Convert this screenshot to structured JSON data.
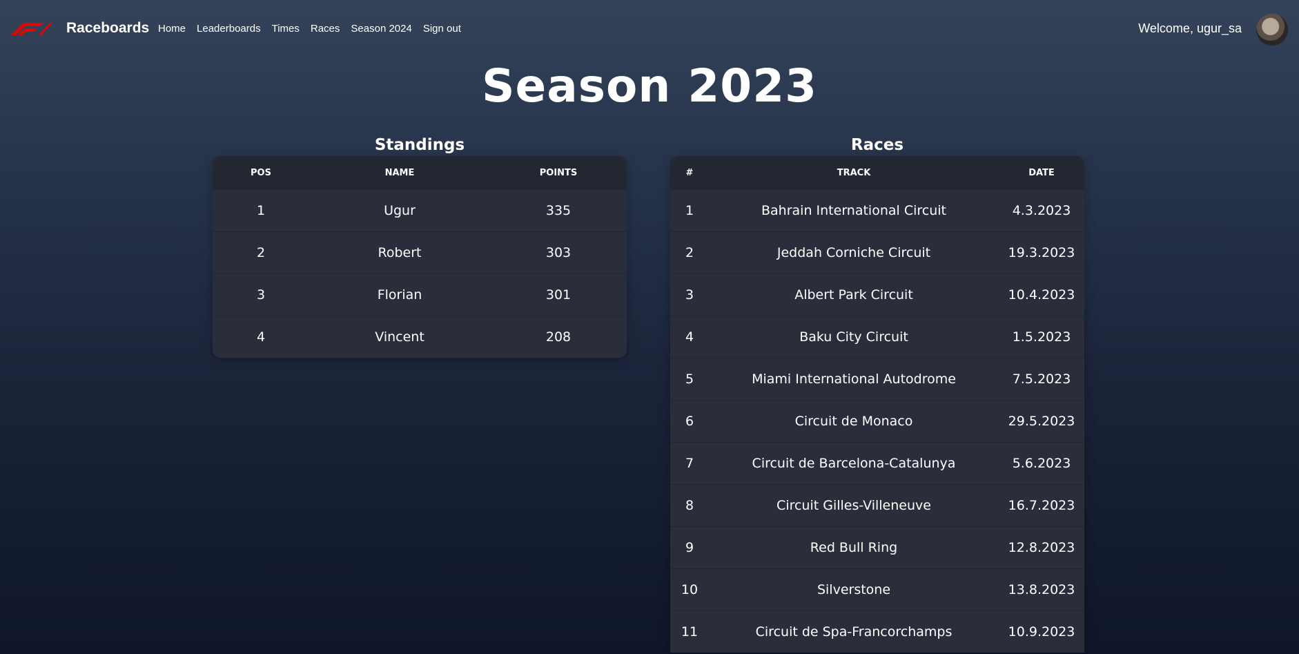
{
  "nav": {
    "brand": "Raceboards",
    "links": [
      "Home",
      "Leaderboards",
      "Times",
      "Races",
      "Season 2024",
      "Sign out"
    ],
    "welcome": "Welcome, ugur_sa"
  },
  "page": {
    "title": "Season 2023"
  },
  "standings": {
    "title": "Standings",
    "headers": [
      "POS",
      "NAME",
      "POINTS"
    ],
    "rows": [
      {
        "pos": "1",
        "name": "Ugur",
        "points": "335"
      },
      {
        "pos": "2",
        "name": "Robert",
        "points": "303"
      },
      {
        "pos": "3",
        "name": "Florian",
        "points": "301"
      },
      {
        "pos": "4",
        "name": "Vincent",
        "points": "208"
      }
    ]
  },
  "races": {
    "title": "Races",
    "headers": [
      "#",
      "TRACK",
      "DATE"
    ],
    "rows": [
      {
        "num": "1",
        "track": "Bahrain International Circuit",
        "date": "4.3.2023"
      },
      {
        "num": "2",
        "track": "Jeddah Corniche Circuit",
        "date": "19.3.2023"
      },
      {
        "num": "3",
        "track": "Albert Park Circuit",
        "date": "10.4.2023"
      },
      {
        "num": "4",
        "track": "Baku City Circuit",
        "date": "1.5.2023"
      },
      {
        "num": "5",
        "track": "Miami International Autodrome",
        "date": "7.5.2023"
      },
      {
        "num": "6",
        "track": "Circuit de Monaco",
        "date": "29.5.2023"
      },
      {
        "num": "7",
        "track": "Circuit de Barcelona-Catalunya",
        "date": "5.6.2023"
      },
      {
        "num": "8",
        "track": "Circuit Gilles-Villeneuve",
        "date": "16.7.2023"
      },
      {
        "num": "9",
        "track": "Red Bull Ring",
        "date": "12.8.2023"
      },
      {
        "num": "10",
        "track": "Silverstone",
        "date": "13.8.2023"
      },
      {
        "num": "11",
        "track": "Circuit de Spa-Francorchamps",
        "date": "10.9.2023"
      }
    ]
  },
  "colors": {
    "logo_red": "#e10600",
    "table_bg": "#2a2e3a",
    "header_bg": "#232732"
  }
}
